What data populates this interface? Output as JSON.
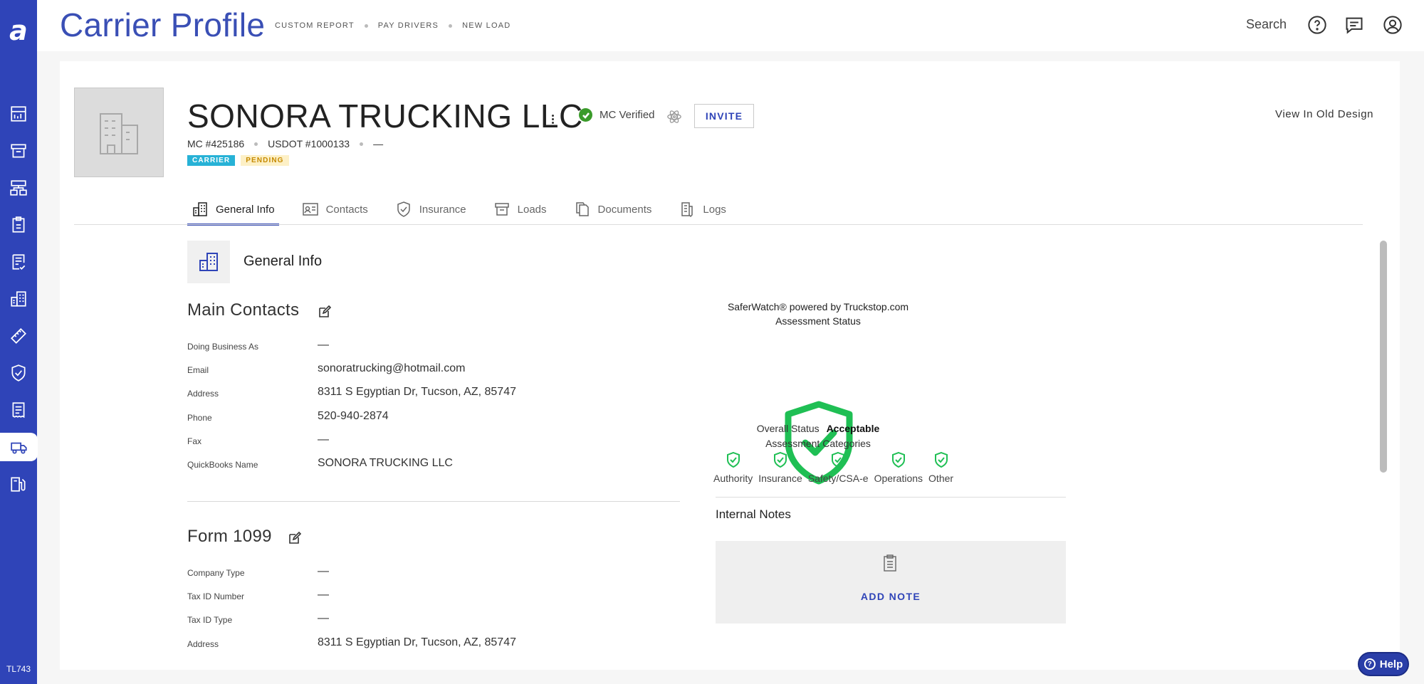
{
  "app": {
    "logo": "a",
    "page_title": "Carrier Profile",
    "tenant_code": "TL743"
  },
  "top_links": [
    "CUSTOM REPORT",
    "PAY DRIVERS",
    "NEW LOAD"
  ],
  "header": {
    "search_label": "Search",
    "icons": [
      "help-icon",
      "chat-icon",
      "account-icon"
    ]
  },
  "sidebar": {
    "items": [
      {
        "name": "reports",
        "icon": "chart-icon"
      },
      {
        "name": "archive",
        "icon": "archive-icon"
      },
      {
        "name": "network",
        "icon": "sitemap-icon"
      },
      {
        "name": "clipboard",
        "icon": "clipboard-icon"
      },
      {
        "name": "billing",
        "icon": "invoice-check-icon"
      },
      {
        "name": "companies",
        "icon": "building-icon"
      },
      {
        "name": "tools",
        "icon": "ruler-icon"
      },
      {
        "name": "compliance",
        "icon": "shield-icon"
      },
      {
        "name": "receipts",
        "icon": "receipt-icon"
      },
      {
        "name": "carriers",
        "icon": "truck-icon",
        "active": true
      },
      {
        "name": "fuel",
        "icon": "fuel-icon"
      }
    ]
  },
  "profile": {
    "name": "SONORA TRUCKING LLC",
    "mc_verified": "MC Verified",
    "invite_label": "INVITE",
    "old_design_label": "View In Old Design",
    "mc_number": "MC #425186",
    "usdot": "USDOT #1000133",
    "extra_id": "—",
    "badges": [
      "CARRIER",
      "PENDING"
    ]
  },
  "tabs": [
    {
      "label": "General Info",
      "icon": "building-icon",
      "active": true
    },
    {
      "label": "Contacts",
      "icon": "contact-card-icon"
    },
    {
      "label": "Insurance",
      "icon": "shield-check-icon"
    },
    {
      "label": "Loads",
      "icon": "box-icon"
    },
    {
      "label": "Documents",
      "icon": "documents-icon"
    },
    {
      "label": "Logs",
      "icon": "logs-icon"
    }
  ],
  "section": {
    "title": "General Info"
  },
  "main_contacts": {
    "title": "Main Contacts",
    "fields": [
      {
        "label": "Doing Business As",
        "value": "—"
      },
      {
        "label": "Email",
        "value": "sonoratrucking@hotmail.com"
      },
      {
        "label": "Address",
        "value": "8311 S Egyptian Dr, Tucson, AZ, 85747"
      },
      {
        "label": "Phone",
        "value": "520-940-2874"
      },
      {
        "label": "Fax",
        "value": "—"
      },
      {
        "label": "QuickBooks Name",
        "value": "SONORA TRUCKING LLC"
      }
    ]
  },
  "form_1099": {
    "title": "Form 1099",
    "fields": [
      {
        "label": "Company Type",
        "value": "—"
      },
      {
        "label": "Tax ID Number",
        "value": "—"
      },
      {
        "label": "Tax ID Type",
        "value": "—"
      },
      {
        "label": "Address",
        "value": "8311 S Egyptian Dr, Tucson, AZ, 85747"
      }
    ]
  },
  "saferwatch": {
    "title_line1": "SaferWatch® powered by Truckstop.com",
    "title_line2": "Assessment Status",
    "overall_label": "Overall Status",
    "overall_value": "Acceptable",
    "categories_title": "Assessment Categories",
    "categories": [
      "Authority",
      "Insurance",
      "Safety/CSA-e",
      "Operations",
      "Other"
    ],
    "status_color": "#1fbf54"
  },
  "internal_notes": {
    "title": "Internal Notes",
    "add_label": "ADD NOTE"
  },
  "help": {
    "label": "Help"
  },
  "colors": {
    "sidebar": "#2f44b8",
    "accent": "#3a4fb5",
    "carrier_badge": "#27b2d6",
    "pending_badge_bg": "#fdf0c6",
    "verified": "#3a9b2a"
  }
}
